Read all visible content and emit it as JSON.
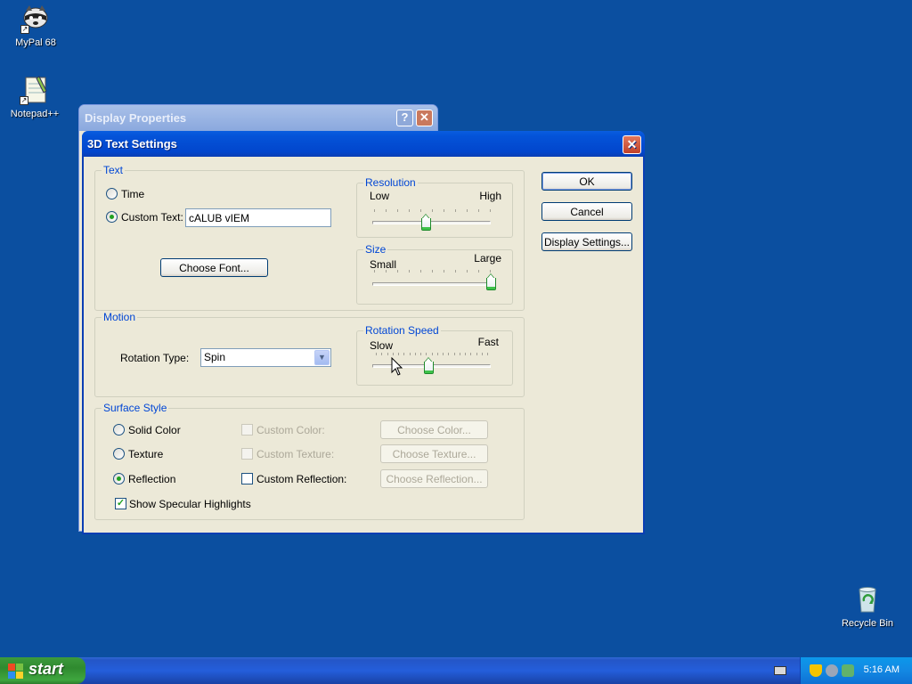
{
  "desktop": {
    "icons": [
      {
        "label": "MyPal 68",
        "icon": "raccoon-icon"
      },
      {
        "label": "Notepad++",
        "icon": "notepad-icon"
      },
      {
        "label": "Recycle Bin",
        "icon": "recycle-bin-icon"
      }
    ]
  },
  "back_window": {
    "title": "Display Properties",
    "help_glyph": "?",
    "close_glyph": "✕"
  },
  "dialog": {
    "title": "3D Text Settings",
    "close_glyph": "✕",
    "text_group": {
      "legend": "Text",
      "time_label": "Time",
      "custom_text_label": "Custom Text:",
      "custom_text_value": "cALUB vIEM",
      "choose_font_label": "Choose Font...",
      "selected": "custom_text"
    },
    "resolution": {
      "legend": "Resolution",
      "min_label": "Low",
      "max_label": "High",
      "value": 0.45
    },
    "size": {
      "legend": "Size",
      "min_label": "Small",
      "max_label": "Large",
      "value": 1.0
    },
    "motion_group": {
      "legend": "Motion",
      "rotation_type_label": "Rotation Type:",
      "rotation_type_value": "Spin"
    },
    "rotation_speed": {
      "legend": "Rotation Speed",
      "min_label": "Slow",
      "max_label": "Fast",
      "value": 0.47
    },
    "surface_group": {
      "legend": "Surface Style",
      "solid_color_label": "Solid Color",
      "texture_label": "Texture",
      "reflection_label": "Reflection",
      "selected": "reflection",
      "custom_color_label": "Custom Color:",
      "custom_texture_label": "Custom Texture:",
      "custom_reflection_label": "Custom Reflection:",
      "choose_color_label": "Choose Color...",
      "choose_texture_label": "Choose Texture...",
      "choose_reflection_label": "Choose Reflection...",
      "show_specular_label": "Show Specular Highlights",
      "show_specular_checked": true,
      "custom_reflection_checked": false
    },
    "buttons": {
      "ok_label": "OK",
      "cancel_label": "Cancel",
      "display_settings_label": "Display Settings..."
    }
  },
  "taskbar": {
    "start_label": "start",
    "clock": "5:16 AM"
  },
  "colors": {
    "desktop_bg": "#0b4fa0",
    "title_active": "#0453d8",
    "group_legend": "#0046d5",
    "taskbar": "#245edb",
    "start_green": "#3c9a3c"
  }
}
